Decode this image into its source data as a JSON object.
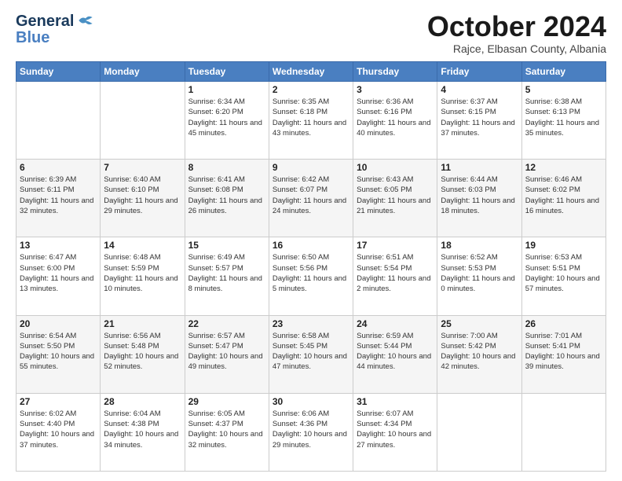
{
  "header": {
    "logo_line1": "General",
    "logo_line2": "Blue",
    "month_title": "October 2024",
    "subtitle": "Rajce, Elbasan County, Albania"
  },
  "days_of_week": [
    "Sunday",
    "Monday",
    "Tuesday",
    "Wednesday",
    "Thursday",
    "Friday",
    "Saturday"
  ],
  "weeks": [
    [
      {
        "day": "",
        "sunrise": "",
        "sunset": "",
        "daylight": ""
      },
      {
        "day": "",
        "sunrise": "",
        "sunset": "",
        "daylight": ""
      },
      {
        "day": "1",
        "sunrise": "Sunrise: 6:34 AM",
        "sunset": "Sunset: 6:20 PM",
        "daylight": "Daylight: 11 hours and 45 minutes."
      },
      {
        "day": "2",
        "sunrise": "Sunrise: 6:35 AM",
        "sunset": "Sunset: 6:18 PM",
        "daylight": "Daylight: 11 hours and 43 minutes."
      },
      {
        "day": "3",
        "sunrise": "Sunrise: 6:36 AM",
        "sunset": "Sunset: 6:16 PM",
        "daylight": "Daylight: 11 hours and 40 minutes."
      },
      {
        "day": "4",
        "sunrise": "Sunrise: 6:37 AM",
        "sunset": "Sunset: 6:15 PM",
        "daylight": "Daylight: 11 hours and 37 minutes."
      },
      {
        "day": "5",
        "sunrise": "Sunrise: 6:38 AM",
        "sunset": "Sunset: 6:13 PM",
        "daylight": "Daylight: 11 hours and 35 minutes."
      }
    ],
    [
      {
        "day": "6",
        "sunrise": "Sunrise: 6:39 AM",
        "sunset": "Sunset: 6:11 PM",
        "daylight": "Daylight: 11 hours and 32 minutes."
      },
      {
        "day": "7",
        "sunrise": "Sunrise: 6:40 AM",
        "sunset": "Sunset: 6:10 PM",
        "daylight": "Daylight: 11 hours and 29 minutes."
      },
      {
        "day": "8",
        "sunrise": "Sunrise: 6:41 AM",
        "sunset": "Sunset: 6:08 PM",
        "daylight": "Daylight: 11 hours and 26 minutes."
      },
      {
        "day": "9",
        "sunrise": "Sunrise: 6:42 AM",
        "sunset": "Sunset: 6:07 PM",
        "daylight": "Daylight: 11 hours and 24 minutes."
      },
      {
        "day": "10",
        "sunrise": "Sunrise: 6:43 AM",
        "sunset": "Sunset: 6:05 PM",
        "daylight": "Daylight: 11 hours and 21 minutes."
      },
      {
        "day": "11",
        "sunrise": "Sunrise: 6:44 AM",
        "sunset": "Sunset: 6:03 PM",
        "daylight": "Daylight: 11 hours and 18 minutes."
      },
      {
        "day": "12",
        "sunrise": "Sunrise: 6:46 AM",
        "sunset": "Sunset: 6:02 PM",
        "daylight": "Daylight: 11 hours and 16 minutes."
      }
    ],
    [
      {
        "day": "13",
        "sunrise": "Sunrise: 6:47 AM",
        "sunset": "Sunset: 6:00 PM",
        "daylight": "Daylight: 11 hours and 13 minutes."
      },
      {
        "day": "14",
        "sunrise": "Sunrise: 6:48 AM",
        "sunset": "Sunset: 5:59 PM",
        "daylight": "Daylight: 11 hours and 10 minutes."
      },
      {
        "day": "15",
        "sunrise": "Sunrise: 6:49 AM",
        "sunset": "Sunset: 5:57 PM",
        "daylight": "Daylight: 11 hours and 8 minutes."
      },
      {
        "day": "16",
        "sunrise": "Sunrise: 6:50 AM",
        "sunset": "Sunset: 5:56 PM",
        "daylight": "Daylight: 11 hours and 5 minutes."
      },
      {
        "day": "17",
        "sunrise": "Sunrise: 6:51 AM",
        "sunset": "Sunset: 5:54 PM",
        "daylight": "Daylight: 11 hours and 2 minutes."
      },
      {
        "day": "18",
        "sunrise": "Sunrise: 6:52 AM",
        "sunset": "Sunset: 5:53 PM",
        "daylight": "Daylight: 11 hours and 0 minutes."
      },
      {
        "day": "19",
        "sunrise": "Sunrise: 6:53 AM",
        "sunset": "Sunset: 5:51 PM",
        "daylight": "Daylight: 10 hours and 57 minutes."
      }
    ],
    [
      {
        "day": "20",
        "sunrise": "Sunrise: 6:54 AM",
        "sunset": "Sunset: 5:50 PM",
        "daylight": "Daylight: 10 hours and 55 minutes."
      },
      {
        "day": "21",
        "sunrise": "Sunrise: 6:56 AM",
        "sunset": "Sunset: 5:48 PM",
        "daylight": "Daylight: 10 hours and 52 minutes."
      },
      {
        "day": "22",
        "sunrise": "Sunrise: 6:57 AM",
        "sunset": "Sunset: 5:47 PM",
        "daylight": "Daylight: 10 hours and 49 minutes."
      },
      {
        "day": "23",
        "sunrise": "Sunrise: 6:58 AM",
        "sunset": "Sunset: 5:45 PM",
        "daylight": "Daylight: 10 hours and 47 minutes."
      },
      {
        "day": "24",
        "sunrise": "Sunrise: 6:59 AM",
        "sunset": "Sunset: 5:44 PM",
        "daylight": "Daylight: 10 hours and 44 minutes."
      },
      {
        "day": "25",
        "sunrise": "Sunrise: 7:00 AM",
        "sunset": "Sunset: 5:42 PM",
        "daylight": "Daylight: 10 hours and 42 minutes."
      },
      {
        "day": "26",
        "sunrise": "Sunrise: 7:01 AM",
        "sunset": "Sunset: 5:41 PM",
        "daylight": "Daylight: 10 hours and 39 minutes."
      }
    ],
    [
      {
        "day": "27",
        "sunrise": "Sunrise: 6:02 AM",
        "sunset": "Sunset: 4:40 PM",
        "daylight": "Daylight: 10 hours and 37 minutes."
      },
      {
        "day": "28",
        "sunrise": "Sunrise: 6:04 AM",
        "sunset": "Sunset: 4:38 PM",
        "daylight": "Daylight: 10 hours and 34 minutes."
      },
      {
        "day": "29",
        "sunrise": "Sunrise: 6:05 AM",
        "sunset": "Sunset: 4:37 PM",
        "daylight": "Daylight: 10 hours and 32 minutes."
      },
      {
        "day": "30",
        "sunrise": "Sunrise: 6:06 AM",
        "sunset": "Sunset: 4:36 PM",
        "daylight": "Daylight: 10 hours and 29 minutes."
      },
      {
        "day": "31",
        "sunrise": "Sunrise: 6:07 AM",
        "sunset": "Sunset: 4:34 PM",
        "daylight": "Daylight: 10 hours and 27 minutes."
      },
      {
        "day": "",
        "sunrise": "",
        "sunset": "",
        "daylight": ""
      },
      {
        "day": "",
        "sunrise": "",
        "sunset": "",
        "daylight": ""
      }
    ]
  ]
}
